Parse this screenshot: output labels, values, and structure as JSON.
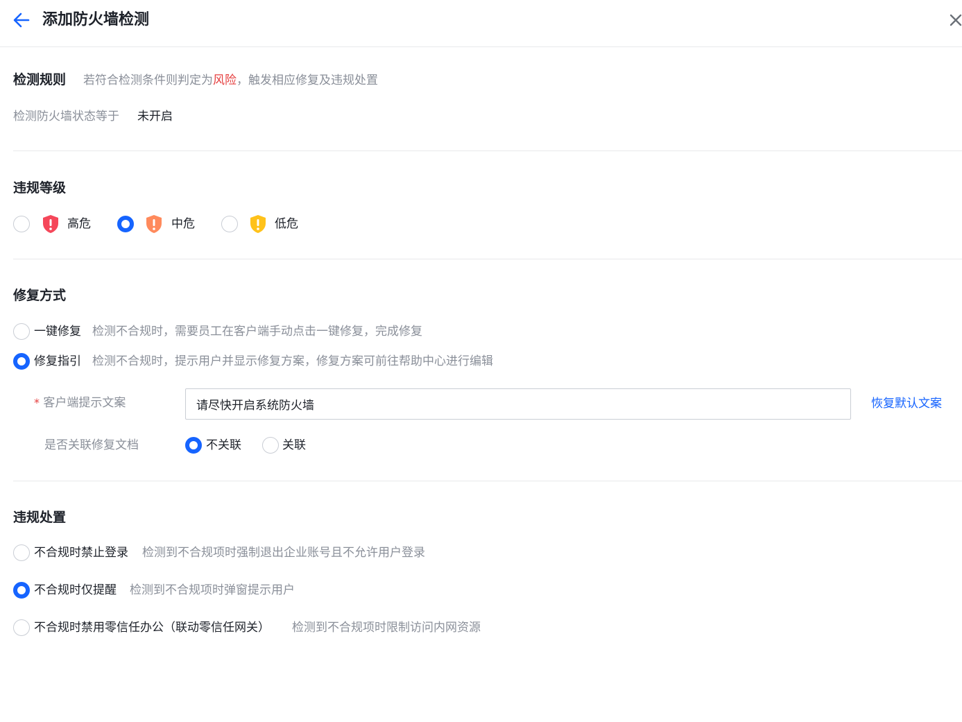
{
  "header": {
    "title": "添加防火墙检测"
  },
  "detection_rule": {
    "title": "检测规则",
    "hint_prefix": "若符合检测条件则判定为",
    "hint_danger": "风险",
    "hint_suffix": "，触发相应修复及违规处置",
    "condition_label": "检测防火墙状态等于",
    "condition_value": "未开启"
  },
  "violation_level": {
    "title": "违规等级",
    "options": [
      {
        "label": "高危",
        "selected": false,
        "color": "#f5475a"
      },
      {
        "label": "中危",
        "selected": true,
        "color": "#ff8a5c"
      },
      {
        "label": "低危",
        "selected": false,
        "color": "#ffc21a"
      }
    ]
  },
  "repair_method": {
    "title": "修复方式",
    "options": [
      {
        "label": "一键修复",
        "desc": "检测不合规时，需要员工在客户端手动点击一键修复，完成修复",
        "selected": false
      },
      {
        "label": "修复指引",
        "desc": "检测不合规时，提示用户并显示修复方案，修复方案可前往帮助中心进行编辑",
        "selected": true
      }
    ],
    "client_tip": {
      "required": "*",
      "label": "客户端提示文案",
      "value": "请尽快开启系统防火墙",
      "restore_link": "恢复默认文案"
    },
    "link_doc": {
      "label": "是否关联修复文档",
      "options": [
        {
          "label": "不关联",
          "selected": true
        },
        {
          "label": "关联",
          "selected": false
        }
      ]
    }
  },
  "violation_handling": {
    "title": "违规处置",
    "options": [
      {
        "label": "不合规时禁止登录",
        "desc": "检测到不合规项时强制退出企业账号且不允许用户登录",
        "selected": false
      },
      {
        "label": "不合规时仅提醒",
        "desc": "检测到不合规项时弹窗提示用户",
        "selected": true
      },
      {
        "label": "不合规时禁用零信任办公（联动零信任网关）",
        "desc": "检测到不合规项时限制访问内网资源",
        "selected": false
      }
    ]
  },
  "colors": {
    "primary": "#1664ff",
    "danger": "#e53e3e",
    "muted_text": "#8a8f99"
  }
}
